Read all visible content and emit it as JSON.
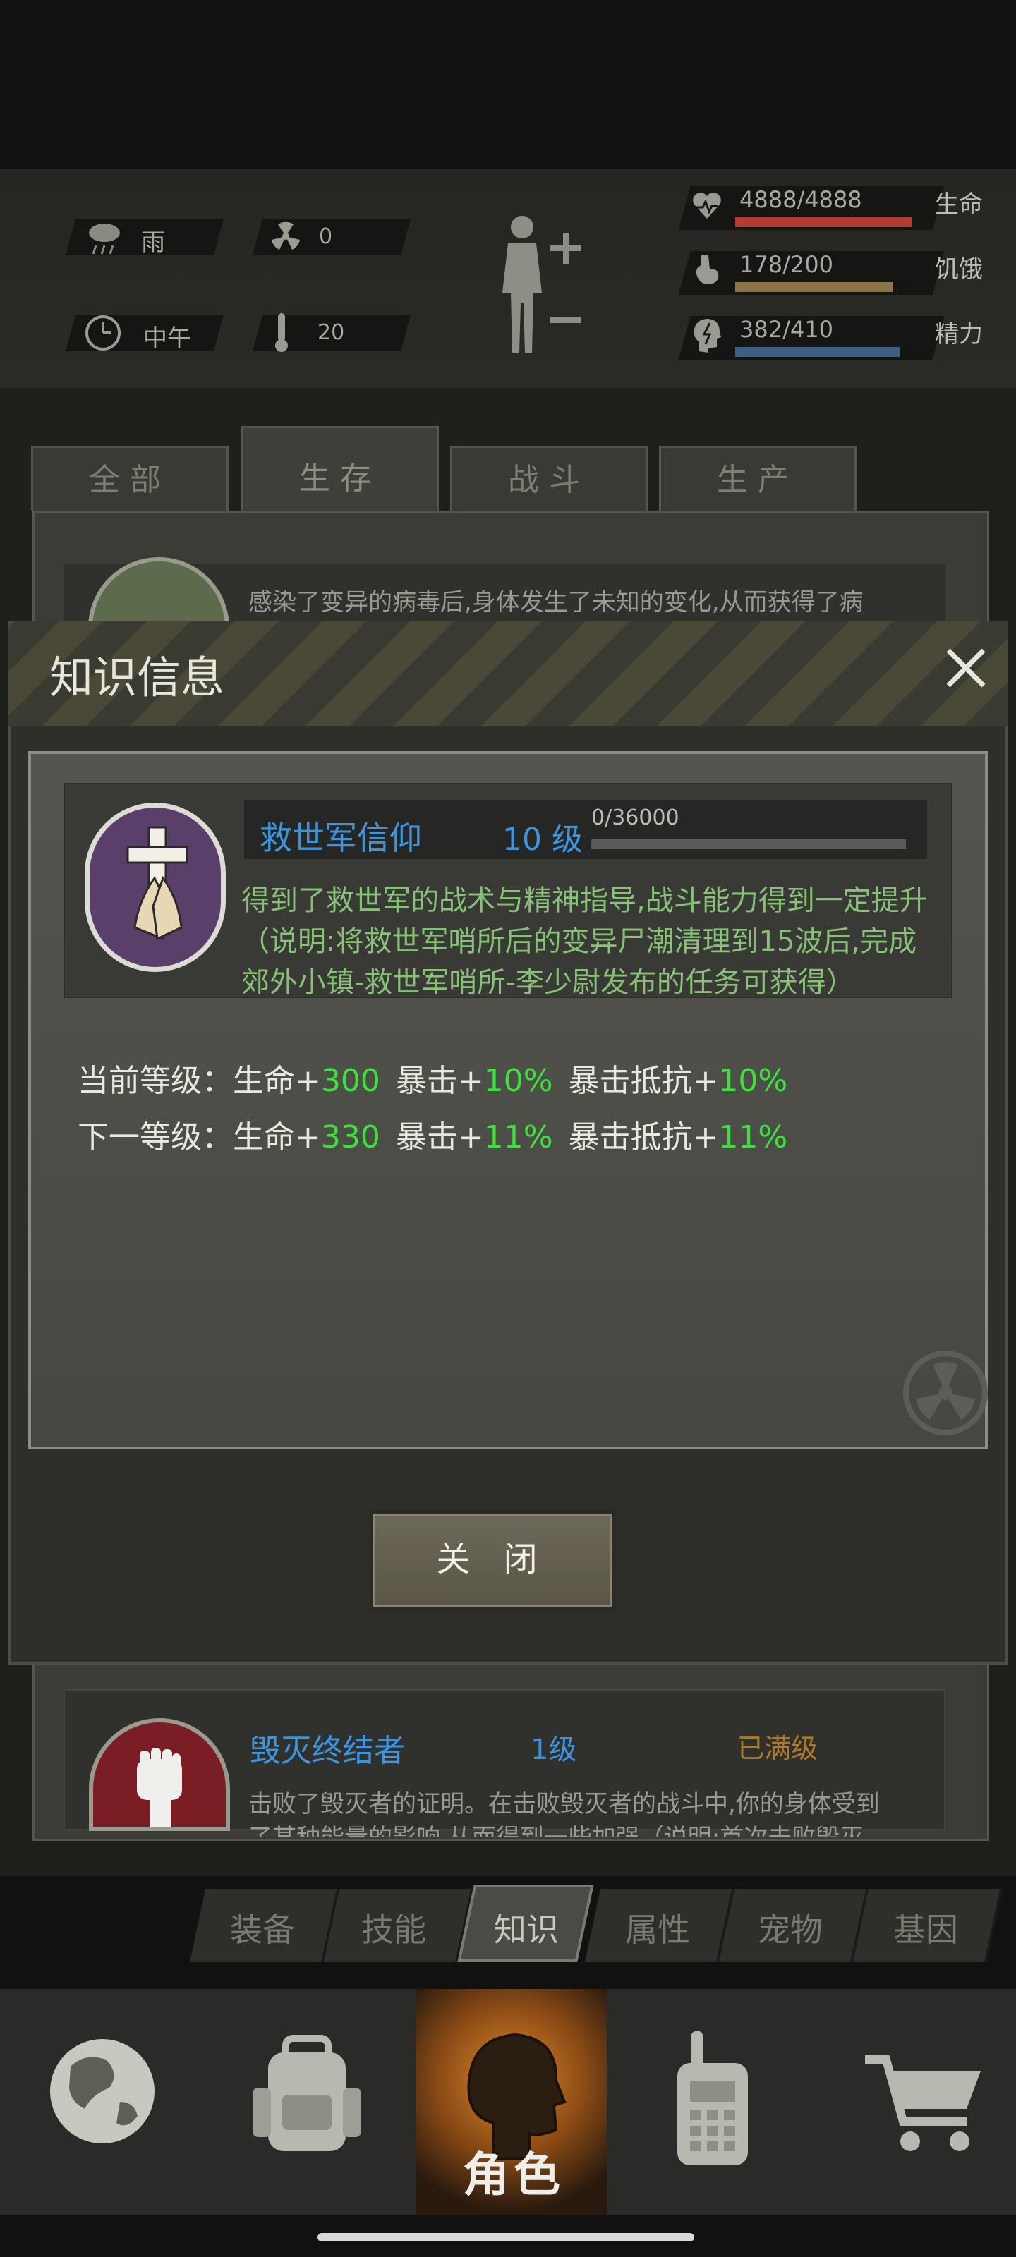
{
  "status": {
    "weather": "雨",
    "radiation": "0",
    "time_of_day": "中午",
    "temperature": "20",
    "hp": {
      "text": "4888/4888",
      "label": "生命",
      "fraction": 1.0,
      "color": "#b53a31"
    },
    "hunger": {
      "text": "178/200",
      "label": "饥饿",
      "fraction": 0.89,
      "color": "#8a7646"
    },
    "energy": {
      "text": "382/410",
      "label": "精力",
      "fraction": 0.93,
      "color": "#3d5f86"
    }
  },
  "tabs": [
    "全部",
    "生存",
    "战斗",
    "生产"
  ],
  "list_preview_top": "感染了变异的病毒后,身体发生了未知的变化,从而获得了病",
  "modal": {
    "title": "知识信息",
    "skill_name": "救世军信仰",
    "skill_level": "10 级",
    "progress_text": "0/36000",
    "progress_fraction": 0.0,
    "desc_line1": "得到了救世军的战术与精神指导,战斗能力得到一定提升",
    "desc_line2": "（说明:将救世军哨所后的变异尸潮清理到15波后,完成",
    "desc_line3": "郊外小镇-救世军哨所-李少尉发布的任务可获得）",
    "current": {
      "label": "当前等级：",
      "hp_label": "生命+",
      "hp_val": "300",
      "crit_label": "暴击+",
      "crit_val": "10%",
      "res_label": "暴击抵抗+",
      "res_val": "10%"
    },
    "next": {
      "label": "下一等级：",
      "hp_label": "生命+",
      "hp_val": "330",
      "crit_label": "暴击+",
      "crit_val": "11%",
      "res_label": "暴击抵抗+",
      "res_val": "11%"
    },
    "close_label": "关 闭"
  },
  "list_item_bottom": {
    "name": "毁灭终结者",
    "level": "1级",
    "status": "已满级",
    "desc_line1": "击败了毁灭者的证明。在击败毁灭者的战斗中,你的身体受到",
    "desc_line2": "了某种能量的影响,从而得到一些加强（说明:首次击败毁灭"
  },
  "sub_tabs": [
    "装备",
    "技能",
    "知识",
    "属性",
    "宠物",
    "基因"
  ],
  "bottom_nav": {
    "role_label": "角色"
  }
}
